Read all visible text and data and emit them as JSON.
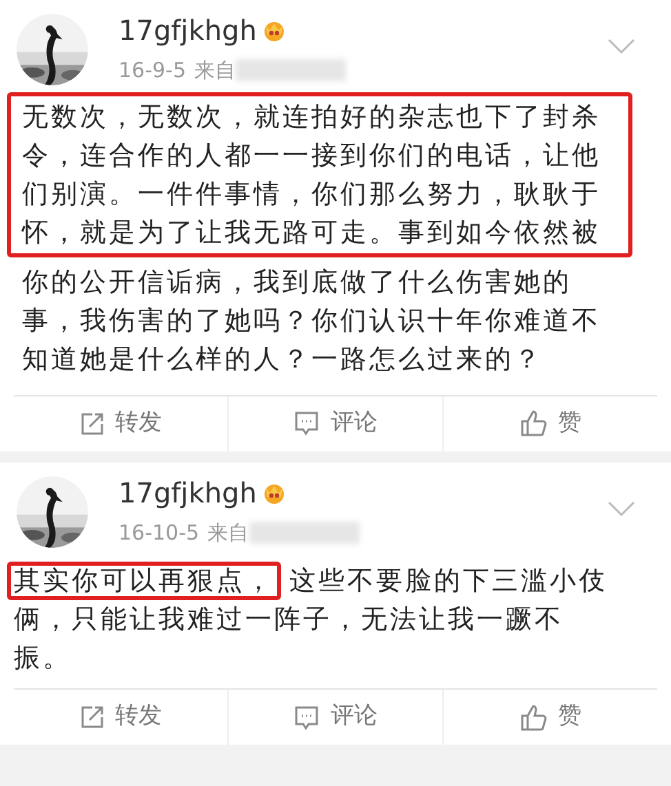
{
  "posts": [
    {
      "username": "17gfjkhgh",
      "date": "16-9-5",
      "source_prefix": "来自",
      "kind": "block",
      "segments": [
        {
          "text": "无数次，无数次，就连拍好的杂志也下了封杀令，连合作的人都一一接到你们的电话，让他们别演。一件件事情，你们那么努力，耿耿于怀，就是为了让我无路可走。事到如今依然被",
          "highlighted": true
        },
        {
          "text": "你的公开信诟病，我到底做了什么伤害她的事，我伤害的了她吗？你们认识十年你难道不知道她是什么样的人？一路怎么过来的？",
          "highlighted": false
        }
      ],
      "actions": [
        {
          "kind": "repost",
          "label": "转发"
        },
        {
          "kind": "comment",
          "label": "评论"
        },
        {
          "kind": "like",
          "label": "赞"
        }
      ]
    },
    {
      "username": "17gfjkhgh",
      "date": "16-10-5",
      "source_prefix": "来自",
      "kind": "inline",
      "segments": [
        {
          "text": "其实你可以再狠点，",
          "highlighted": true
        },
        {
          "text": "这些不要脸的下三滥小伎俩，只能让我难过一阵子，无法让我一蹶不振。",
          "highlighted": false
        }
      ],
      "actions": [
        {
          "kind": "repost",
          "label": "转发"
        },
        {
          "kind": "comment",
          "label": "评论"
        },
        {
          "kind": "like",
          "label": "赞"
        }
      ]
    }
  ]
}
